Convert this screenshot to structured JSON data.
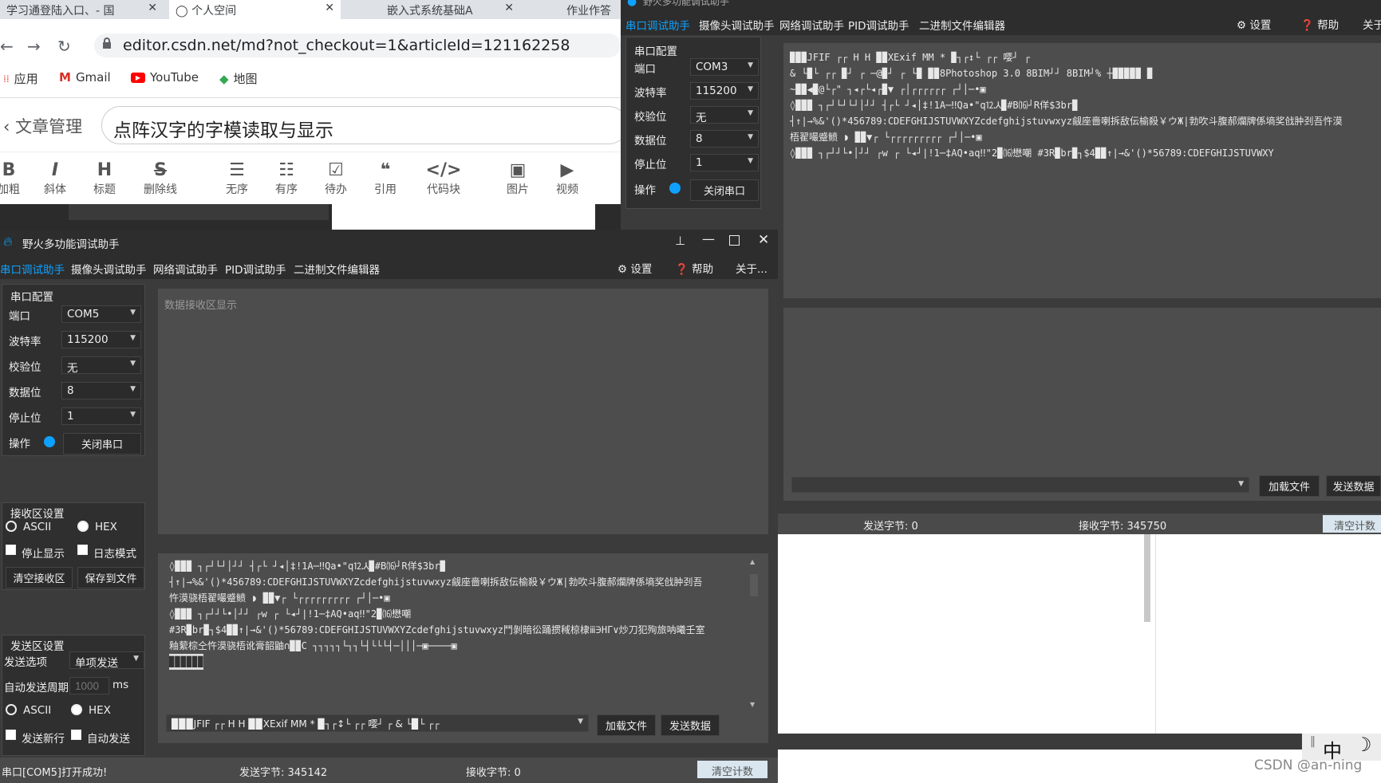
{
  "browser": {
    "tabs": [
      {
        "label": "学习通登陆入口、- 国"
      },
      {
        "label": "个人空间"
      },
      {
        "label": "嵌入式系统基础A"
      },
      {
        "label": "作业作答"
      }
    ],
    "url": "editor.csdn.net/md?not_checkout=1&articleId=121162258",
    "bookmarks": [
      {
        "label": "应用",
        "icon": "apps-icon"
      },
      {
        "label": "Gmail",
        "icon": "gmail-icon"
      },
      {
        "label": "YouTube",
        "icon": "youtube-icon"
      },
      {
        "label": "地图",
        "icon": "maps-icon"
      }
    ],
    "article_manage": "文章管理",
    "article_title": "点阵汉字的字模读取与显示",
    "toolbar": [
      {
        "icon": "B",
        "label": "加粗"
      },
      {
        "icon": "I",
        "label": "斜体"
      },
      {
        "icon": "H",
        "label": "标题"
      },
      {
        "icon": "S",
        "label": "删除线"
      },
      {
        "icon": "☰",
        "label": "无序"
      },
      {
        "icon": "☷",
        "label": "有序"
      },
      {
        "icon": "☑",
        "label": "待办"
      },
      {
        "icon": "❝",
        "label": "引用"
      },
      {
        "icon": "</>",
        "label": "代码块"
      },
      {
        "icon": "▣",
        "label": "图片"
      },
      {
        "icon": "▶",
        "label": "视频"
      }
    ]
  },
  "left_tool": {
    "title": "野火多功能调试助手",
    "menu": [
      "串口调试助手",
      "摄像头调试助手",
      "网络调试助手",
      "PID调试助手",
      "二进制文件编辑器"
    ],
    "menu_right": [
      "⚙ 设置",
      "❓ 帮助",
      "关于..."
    ],
    "serial_config": {
      "title": "串口配置",
      "rows": [
        {
          "label": "端口",
          "value": "COM5"
        },
        {
          "label": "波特率",
          "value": "115200"
        },
        {
          "label": "校验位",
          "value": "无"
        },
        {
          "label": "数据位",
          "value": "8"
        },
        {
          "label": "停止位",
          "value": "1"
        }
      ],
      "op_label": "操作",
      "close_port": "关闭串口"
    },
    "receive_settings": {
      "title": "接收区设置",
      "ascii": "ASCII",
      "hex": "HEX",
      "stop_display": "停止显示",
      "log_mode": "日志模式",
      "clear_rx": "清空接收区",
      "save_file": "保存到文件"
    },
    "send_settings": {
      "title": "发送区设置",
      "send_option_label": "发送选项",
      "send_option_value": "单项发送",
      "auto_period_label": "自动发送周期",
      "auto_period_placeholder": "1000",
      "ms": "ms",
      "ascii": "ASCII",
      "hex": "HEX",
      "send_newline": "发送新行",
      "auto_send": "自动发送"
    },
    "rx_placeholder": "数据接收区显示",
    "rx_lines": [
      "◊▉▉▉ ┐┌┘└┘│┘┘   ┤┌└ ┘◂│‡!1A─‼Qa•\"q⒓⅄▉#B⒃┘R佯$3br▉",
      "┤↑|→%&'()*456789:CDEFGHIJSTUVWXYZcdefghijstuvwxyz觎座嗇喇拆敌伝榆殺￥ウЖ|勃吹斗腹郝爛牌係墒奖戗肿刭吾",
      "忤漠骁梧翟嘬蹙鲼 ◗ ▉▉▼┌  └┌┌┌┌┌┌┌┌┌        ┌┘│─•▣",
      "◊▉▉▉ ┐┌┘┘└•│┘┘   ┌w  ┌ └◂┘|!1─‡AQ•aq‼\"2▉⒃懋嘲",
      "#3R▉br▉┐$4▉▉↑|→&'()*56789:CDEFGHIJSTUVWXYZcdefghijstuvwxyz鬥剝暗彸踊掼稢椋棣ⅲ∋HΓ∨炒刀犯殉旅呐曦壬室",
      "釉蕠棕仝忤漠骁梧讹膏韶鼬∩▉▉C ┐┐┐┐┐└┐┐└┤└└└┤─│││─▣────▣",
      "▉▉▉▉▉▉"
    ],
    "tx_text": "▉▉▉JFIF ┌┌  H H  ▉▉XExif  MM *  ▉┐┌↕└  ┌┌  嘤┘  ┌  &   └▉└  ┌┌",
    "load_file": "加载文件",
    "send_data": "发送数据",
    "status_msg": "串口[COM5]打开成功!",
    "sent_bytes": "发送字节: 345142",
    "recv_bytes": "接收字节: 0",
    "clear_count": "清空计数"
  },
  "right_tool": {
    "title": "野火多功能调试助手",
    "menu": [
      "串口调试助手",
      "摄像头调试助手",
      "网络调试助手",
      "PID调试助手",
      "二进制文件编辑器"
    ],
    "menu_right": [
      "⚙ 设置",
      "❓ 帮助",
      "关于"
    ],
    "serial_config": {
      "title": "串口配置",
      "rows": [
        {
          "label": "端口",
          "value": "COM3"
        },
        {
          "label": "波特率",
          "value": "115200"
        },
        {
          "label": "校验位",
          "value": "无"
        },
        {
          "label": "数据位",
          "value": "8"
        },
        {
          "label": "停止位",
          "value": "1"
        }
      ],
      "op_label": "操作",
      "close_port": "关闭串口"
    },
    "rx_lines": [
      "▉▉▉JFIF ┌┌  H H   ▉▉XExif   MM *    ▉┐┌↕└    ┌┌   嘤┘    ┌",
      "&        └▉└    ┌┌  ▉┘    ┌ ─@▉┘    ┌   └▉    ▉▉8Photoshop 3.0  8BIM┘┘          8BIM┘%         ┼▉▉▉▉▉          ▉",
      "~▉▉◀▉@└┌\"  ┐◂┌└◂┌▉▼   ┌│┌┌┌┌┌┌            ┌┘│─•▣",
      "◊▉▉▉  ┐┌┘└┘└┘│┘┘    ┤┌└ ┘◂│‡!1A─‼Qa•\"q⒓⅄▉#B⒃┘R佯$3br▉",
      "┤↑|→%&'()*456789:CDEFGHIJSTUVWXYZcdefghijstuvwxyz觎座嗇喇拆敌伝榆殺￥ウЖ|勃吹斗腹郝爛牌係墒奖戗肿刭吾忤漠",
      "梧翟嘬蹙鲼 ◗ ▉▉▼┌  └┌┌┌┌┌┌┌┌┌        ┌┘│─•▣",
      "◊▉▉▉  ┐┌┘┘└•│┘┘    ┌w   ┌ └◂┘|!1─‡AQ•aq‼\"2▉⒃懋嘲                 #3R▉br▉┐$4▉▉↑|→&'()*56789:CDEFGHIJSTUVWXY"
    ],
    "load_file": "加载文件",
    "send_data": "发送数据",
    "sent_bytes": "发送字节: 0",
    "recv_bytes": "接收字节: 345750",
    "clear_count": "清空计数"
  },
  "ime": {
    "lang": "中",
    "moon": "☽"
  },
  "watermark": "CSDN @an-ning"
}
